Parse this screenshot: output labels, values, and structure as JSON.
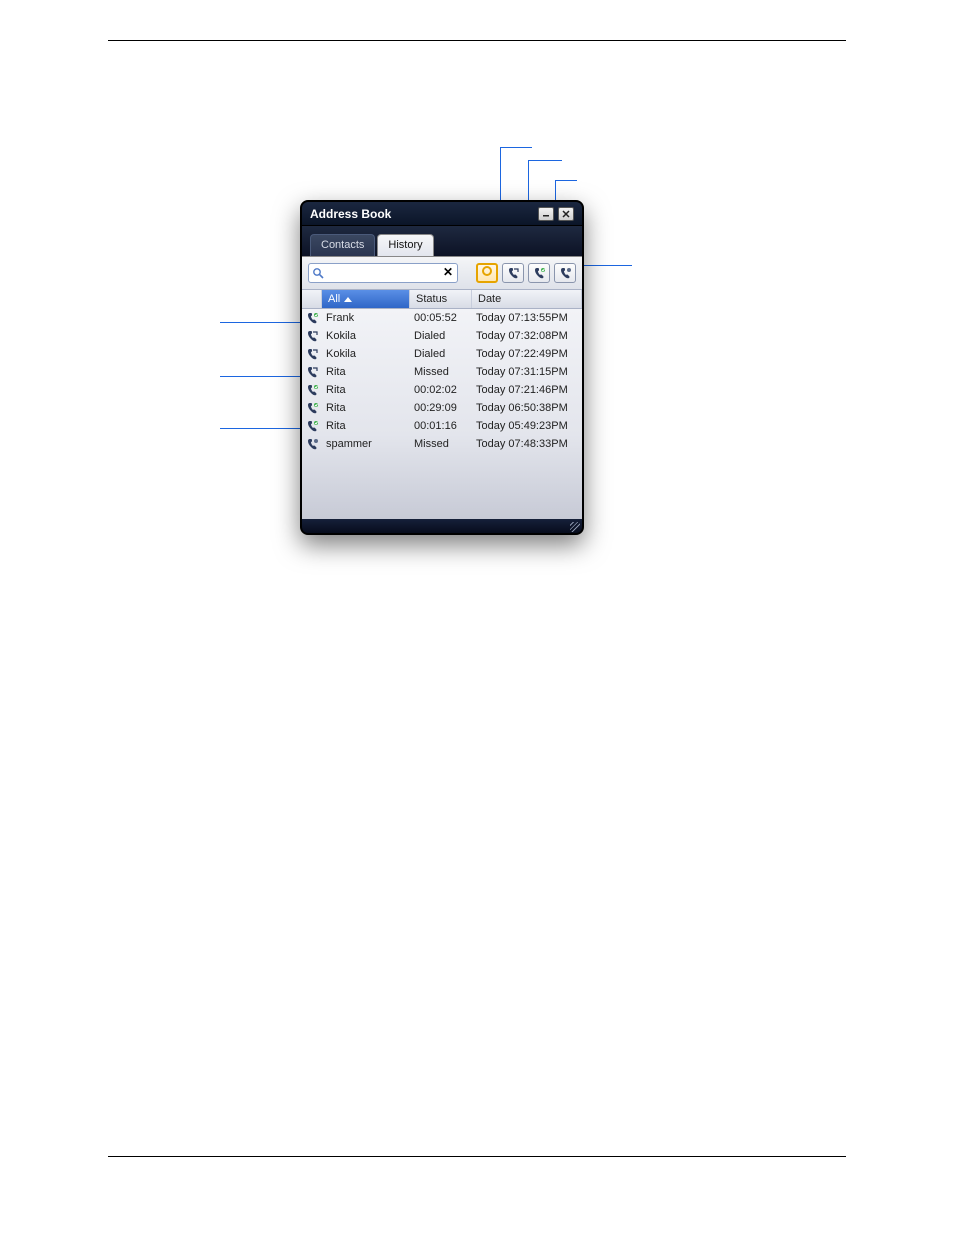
{
  "window": {
    "title": "Address Book"
  },
  "tabs": [
    {
      "id": "contacts",
      "label": "Contacts",
      "active": false
    },
    {
      "id": "history",
      "label": "History",
      "active": true
    }
  ],
  "search": {
    "placeholder": "",
    "value": ""
  },
  "filters": [
    {
      "id": "all",
      "selected": true
    },
    {
      "id": "dialed",
      "selected": false
    },
    {
      "id": "received",
      "selected": false
    },
    {
      "id": "missed",
      "selected": false
    }
  ],
  "columns": {
    "all": "All",
    "status": "Status",
    "date": "Date"
  },
  "sort": {
    "column": "all",
    "direction": "asc"
  },
  "rows": [
    {
      "icon": "received",
      "name": "Frank",
      "status": "00:05:52",
      "date": "Today 07:13:55PM"
    },
    {
      "icon": "dialed",
      "name": "Kokila",
      "status": "Dialed",
      "date": "Today 07:32:08PM"
    },
    {
      "icon": "dialed",
      "name": "Kokila",
      "status": "Dialed",
      "date": "Today 07:22:49PM"
    },
    {
      "icon": "dialed",
      "name": "Rita",
      "status": "Missed",
      "date": "Today 07:31:15PM"
    },
    {
      "icon": "received",
      "name": "Rita",
      "status": "00:02:02",
      "date": "Today 07:21:46PM"
    },
    {
      "icon": "received",
      "name": "Rita",
      "status": "00:29:09",
      "date": "Today 06:50:38PM"
    },
    {
      "icon": "received",
      "name": "Rita",
      "status": "00:01:16",
      "date": "Today 05:49:23PM"
    },
    {
      "icon": "missed",
      "name": "spammer",
      "status": "Missed",
      "date": "Today 07:48:33PM"
    }
  ],
  "colors": {
    "accent_dark": "#0f1a34",
    "header_sorted": "#3f73d0",
    "filter_selected_border": "#e6a400"
  }
}
